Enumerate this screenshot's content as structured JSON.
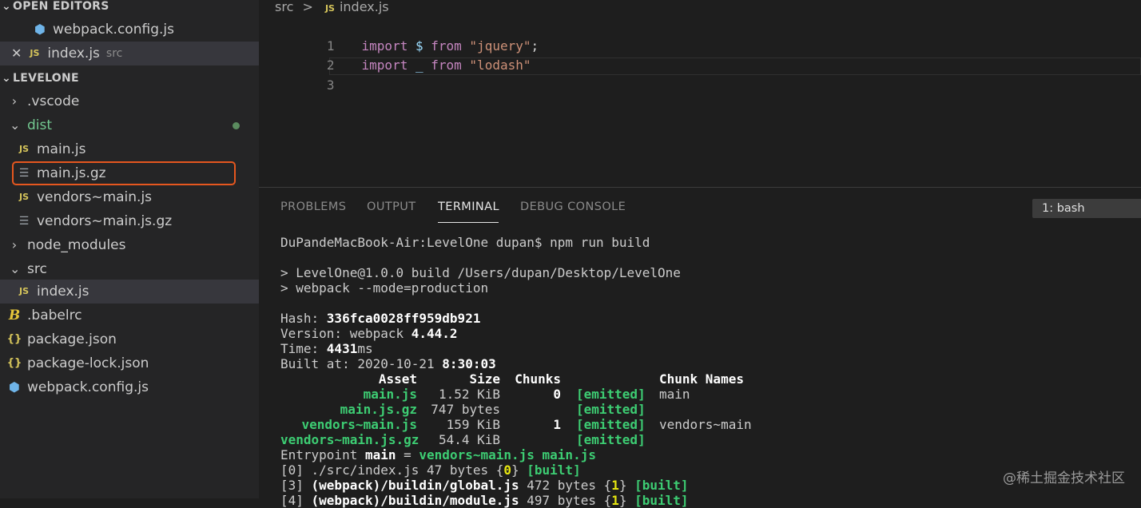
{
  "explorer": {
    "open_editors_title": "OPEN EDITORS",
    "open_editors": [
      {
        "label": "webpack.config.js",
        "icon": "webpack-icon",
        "dir": ""
      },
      {
        "label": "index.js",
        "icon": "js-file-icon",
        "dir": "src"
      }
    ],
    "project_title": "LEVELONE",
    "tree": [
      {
        "label": ".vscode",
        "icon": "chevron-right-icon"
      },
      {
        "label": "dist",
        "icon": "chevron-down-icon"
      },
      {
        "label": "main.js",
        "icon": "js-file-icon"
      },
      {
        "label": "main.js.gz",
        "icon": "text-file-icon"
      },
      {
        "label": "vendors~main.js",
        "icon": "js-file-icon"
      },
      {
        "label": "vendors~main.js.gz",
        "icon": "text-file-icon"
      },
      {
        "label": "node_modules",
        "icon": "chevron-right-icon"
      },
      {
        "label": "src",
        "icon": "chevron-down-icon"
      },
      {
        "label": "index.js",
        "icon": "js-file-icon"
      },
      {
        "label": ".babelrc",
        "icon": "babel-icon"
      },
      {
        "label": "package.json",
        "icon": "json-icon"
      },
      {
        "label": "package-lock.json",
        "icon": "json-icon"
      },
      {
        "label": "webpack.config.js",
        "icon": "webpack-icon"
      }
    ]
  },
  "editor": {
    "breadcrumb": {
      "folder": "src",
      "separator": ">",
      "file": "index.js"
    },
    "lines": [
      {
        "n": "1",
        "kw": "import",
        "id": "$",
        "from": "from",
        "str": "\"jquery\"",
        "end": ";"
      },
      {
        "n": "2",
        "kw": "import",
        "id": "_",
        "from": "from",
        "str": "\"lodash\"",
        "end": ""
      },
      {
        "n": "3",
        "kw": "",
        "id": "",
        "from": "",
        "str": "",
        "end": ""
      }
    ]
  },
  "panel": {
    "tabs": [
      "PROBLEMS",
      "OUTPUT",
      "TERMINAL",
      "DEBUG CONSOLE"
    ],
    "active_tab": "TERMINAL",
    "terminal_select": "1: bash"
  },
  "terminal": {
    "prompt": "DuPandeMacBook-Air:LevelOne dupan$ npm run build",
    "script1": "> LevelOne@1.0.0 build /Users/dupan/Desktop/LevelOne",
    "script2": "> webpack --mode=production",
    "hash_label": "Hash: ",
    "hash": "336fca0028ff959db921",
    "version_label": "Version: webpack ",
    "version": "4.44.2",
    "time_label": "Time: ",
    "time": "4431",
    "time_unit": "ms",
    "built_label": "Built at: 2020-10-21 ",
    "built_time": "8:30:03",
    "header": {
      "asset": "Asset",
      "size": "Size",
      "chunks": "Chunks",
      "names": "Chunk Names"
    },
    "assets": [
      {
        "asset": "main.js",
        "size": "1.52 KiB",
        "chunk": "0",
        "status": "[emitted]",
        "name": "main"
      },
      {
        "asset": "main.js.gz",
        "size": "747 bytes",
        "chunk": "",
        "status": "[emitted]",
        "name": ""
      },
      {
        "asset": "vendors~main.js",
        "size": "159 KiB",
        "chunk": "1",
        "status": "[emitted]",
        "name": "vendors~main"
      },
      {
        "asset": "vendors~main.js.gz",
        "size": "54.4 KiB",
        "chunk": "",
        "status": "[emitted]",
        "name": ""
      }
    ],
    "entry_label": "Entrypoint ",
    "entry_main": "main",
    "entry_eq": " = ",
    "entry_files": "vendors~main.js main.js",
    "modules": [
      {
        "idx": "[0] ",
        "path": "./src/index.js",
        "size": " 47 bytes {",
        "chunk": "0",
        "close": "} ",
        "status": "[built]",
        "bold": false
      },
      {
        "idx": "[3] ",
        "path": "(webpack)/buildin/global.js",
        "size": " 472 bytes {",
        "chunk": "1",
        "close": "} ",
        "status": "[built]",
        "bold": true
      },
      {
        "idx": "[4] ",
        "path": "(webpack)/buildin/module.js",
        "size": " 497 bytes {",
        "chunk": "1",
        "close": "} ",
        "status": "[built]",
        "bold": true
      }
    ]
  },
  "watermark": "@稀土掘金技术社区"
}
